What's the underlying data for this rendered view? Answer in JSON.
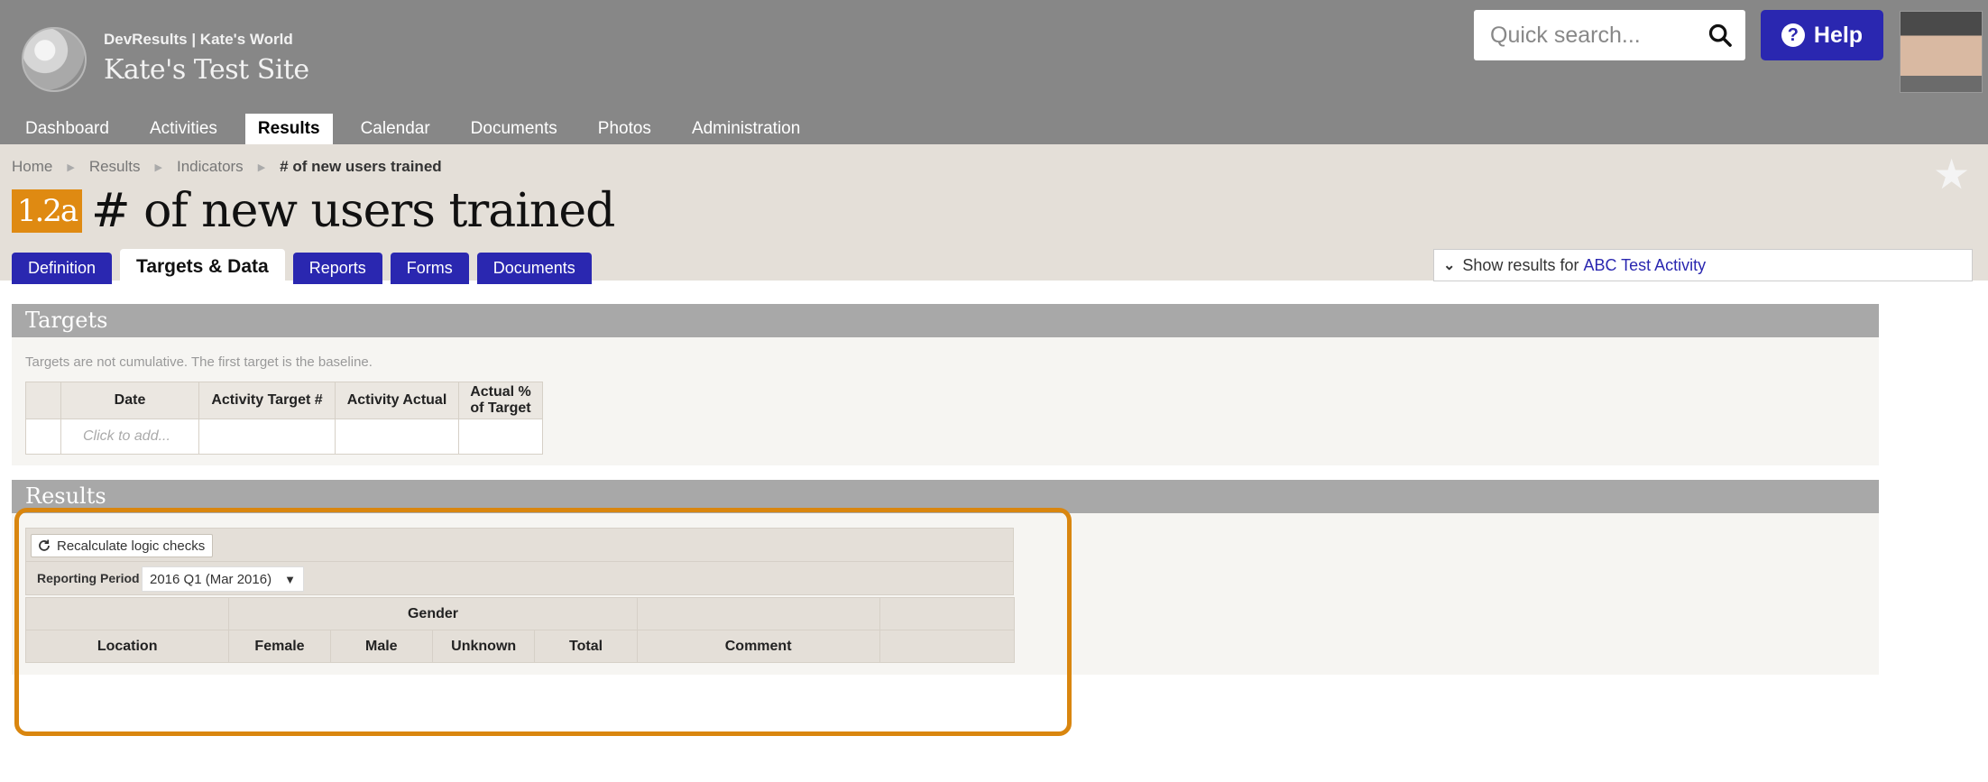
{
  "header": {
    "site_super": "DevResults | Kate's World",
    "site_title": "Kate's Test Site",
    "search_placeholder": "Quick search...",
    "help_label": "Help"
  },
  "nav": {
    "items": [
      {
        "label": "Dashboard"
      },
      {
        "label": "Activities"
      },
      {
        "label": "Results"
      },
      {
        "label": "Calendar"
      },
      {
        "label": "Documents"
      },
      {
        "label": "Photos"
      },
      {
        "label": "Administration"
      }
    ]
  },
  "breadcrumb": {
    "items": [
      "Home",
      "Results",
      "Indicators"
    ],
    "current": "# of new users trained"
  },
  "indicator": {
    "code": "1.2a",
    "title": "# of new users trained"
  },
  "tabs": [
    {
      "label": "Definition"
    },
    {
      "label": "Targets & Data"
    },
    {
      "label": "Reports"
    },
    {
      "label": "Forms"
    },
    {
      "label": "Documents"
    }
  ],
  "filter": {
    "prefix": "Show results for",
    "activity": "ABC Test Activity"
  },
  "targets": {
    "heading": "Targets",
    "note": "Targets are not cumulative. The first target is the baseline.",
    "columns": [
      "",
      "Date",
      "Activity Target #",
      "Activity Actual",
      "Actual %\nof Target"
    ],
    "add_placeholder": "Click to add..."
  },
  "results": {
    "heading": "Results",
    "recalc_label": "Recalculate logic checks",
    "period_label": "Reporting Period",
    "period_value": "2016 Q1 (Mar 2016)",
    "group_header": "Gender",
    "columns": [
      "Location",
      "Female",
      "Male",
      "Unknown",
      "Total",
      "Comment"
    ]
  },
  "colors": {
    "brand_blue": "#2a27b0",
    "highlight_orange": "#d9860f",
    "badge_orange": "#df8a12"
  }
}
